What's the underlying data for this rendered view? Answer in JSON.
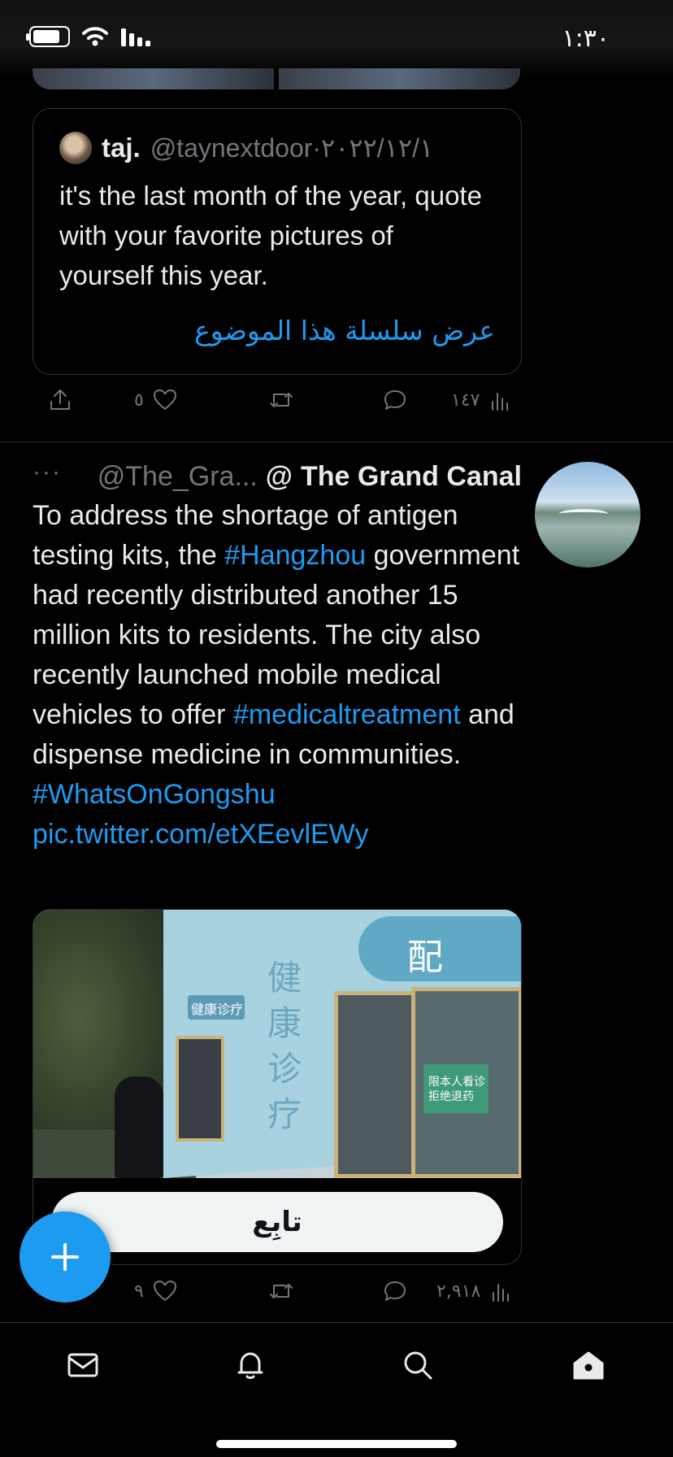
{
  "status_bar": {
    "time": "١:٣٠"
  },
  "quoted_tweet": {
    "name": "taj.",
    "handle": "@taynextdoor",
    "separator": "·",
    "date": "٢٠٢٢/١٢/١",
    "text": "it's the last month of the year, quote with your favorite pictures of yourself this year.",
    "show_thread": "عرض سلسلة هذا الموضوع"
  },
  "quoted_actions": {
    "likes": "٥",
    "views": "١٤٧"
  },
  "main_tweet": {
    "more": "···",
    "handle": "@The_Gra...",
    "at_symbol": "@",
    "name": "The Grand Canal",
    "text_1": "To address the shortage of antigen testing kits, the ",
    "hashtag_1": "#Hangzhou",
    "text_2": " government had recently distributed another 15 million kits to residents. The city also recently launched mobile medical vehicles to offer ",
    "hashtag_2": "#medicaltreatment",
    "text_3": " and dispense medicine in communities. ",
    "hashtag_3": "#WhatsOnGongshu",
    "pic_link": "pic.twitter.com/etXEevlEWy",
    "photo_text": {
      "banner": "配 药",
      "vertical": "健康诊疗",
      "small_sign": "健康诊疗",
      "green_sign": "限本人看诊 拒绝退药"
    },
    "follow_label": "تابِع"
  },
  "main_actions": {
    "likes": "٩",
    "views": "٢,٩١٨"
  },
  "colors": {
    "accent": "#1d9bf0",
    "background": "#000000",
    "muted": "#71767b"
  },
  "icons": {
    "fab": "plus-icon",
    "nav": [
      "mail-icon",
      "bell-icon",
      "search-icon",
      "home-icon"
    ]
  }
}
